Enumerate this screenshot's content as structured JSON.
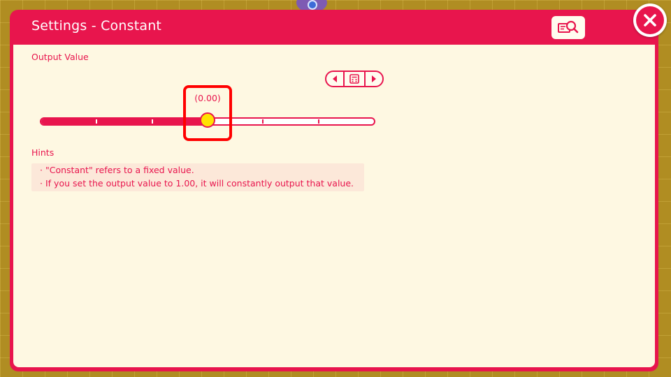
{
  "dialog": {
    "title": "Settings - Constant"
  },
  "output": {
    "label": "Output Value",
    "value_text": "(0.00)",
    "slider": {
      "min": -1.0,
      "max": 1.0,
      "value": 0.0,
      "tick_count": 5
    }
  },
  "hints": {
    "label": "Hints",
    "bullet": "·",
    "items": [
      "\"Constant\" refers to a fixed value.",
      "If you set the output value to 1.00, it will constantly output that value."
    ]
  },
  "icons": {
    "help": "help-search-icon",
    "close": "close-icon",
    "prev": "triangle-left-icon",
    "next": "triangle-right-icon",
    "calculator": "calculator-icon"
  },
  "colors": {
    "accent": "#e8154d",
    "panel": "#fef8e2",
    "thumb": "#ffe200",
    "highlight": "#ff0000",
    "hint_bg": "#fce8d9",
    "background": "#b08d22"
  }
}
